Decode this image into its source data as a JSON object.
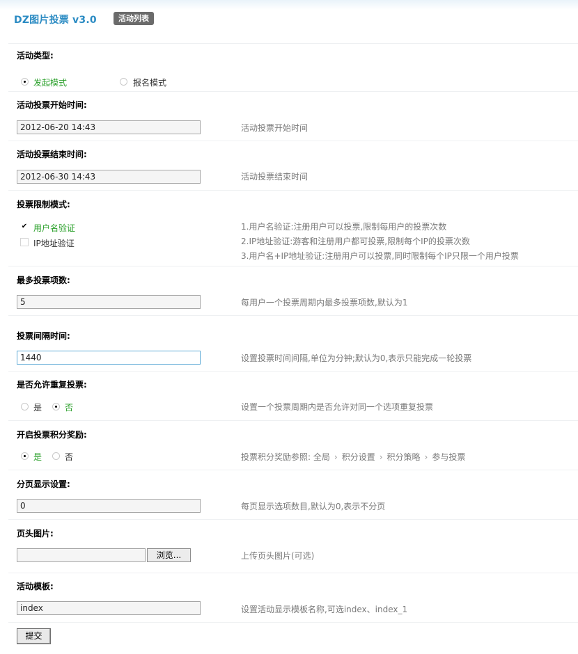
{
  "header": {
    "title": "DZ图片投票  v3.0",
    "list_button": "活动列表"
  },
  "activity_type": {
    "label": "活动类型:",
    "options": [
      "发起模式",
      "报名模式"
    ],
    "selected": "发起模式"
  },
  "start_time": {
    "label": "活动投票开始时间:",
    "value": "2012-06-20 14:43",
    "hint": "活动投票开始时间"
  },
  "end_time": {
    "label": "活动投票结束时间:",
    "value": "2012-06-30 14:43",
    "hint": "活动投票结束时间"
  },
  "limit_mode": {
    "label": "投票限制模式:",
    "options": [
      {
        "label": "用户名验证",
        "checked": true
      },
      {
        "label": "IP地址验证",
        "checked": false
      }
    ],
    "hints": [
      "1.用户名验证:注册用户可以投票,限制每用户的投票次数",
      "2.IP地址验证:游客和注册用户都可投票,限制每个IP的投票次数",
      "3.用户名+IP地址验证:注册用户可以投票,同时限制每个IP只限一个用户投票"
    ]
  },
  "max_items": {
    "label": "最多投票项数:",
    "value": "5",
    "hint": "每用户一个投票周期内最多投票项数,默认为1"
  },
  "interval": {
    "label": "投票间隔时间:",
    "value": "1440",
    "hint": "设置投票时间间隔,单位为分钟;默认为0,表示只能完成一轮投票"
  },
  "allow_repeat": {
    "label": "是否允许重复投票:",
    "options": [
      "是",
      "否"
    ],
    "selected": "否",
    "hint": "设置一个投票周期内是否允许对同一个选项重复投票"
  },
  "reward": {
    "label": "开启投票积分奖励:",
    "options": [
      "是",
      "否"
    ],
    "selected": "是",
    "hint_prefix": "投票积分奖励参照: ",
    "hint_crumbs": [
      "全局",
      "积分设置",
      "积分策略",
      "参与投票"
    ]
  },
  "page_size": {
    "label": "分页显示设置:",
    "value": "0",
    "hint": "每页显示选项数目,默认为0,表示不分页"
  },
  "header_image": {
    "label": "页头图片:",
    "browse": "浏览...",
    "hint": "上传页头图片(可选)"
  },
  "template": {
    "label": "活动模板:",
    "value": "index",
    "hint": "设置活动显示模板名称,可选index、index_1"
  },
  "submit": "提交",
  "colors": {
    "title": "#2b8bc3",
    "active_option": "#2aa02a",
    "hint": "#7a7a7a"
  }
}
